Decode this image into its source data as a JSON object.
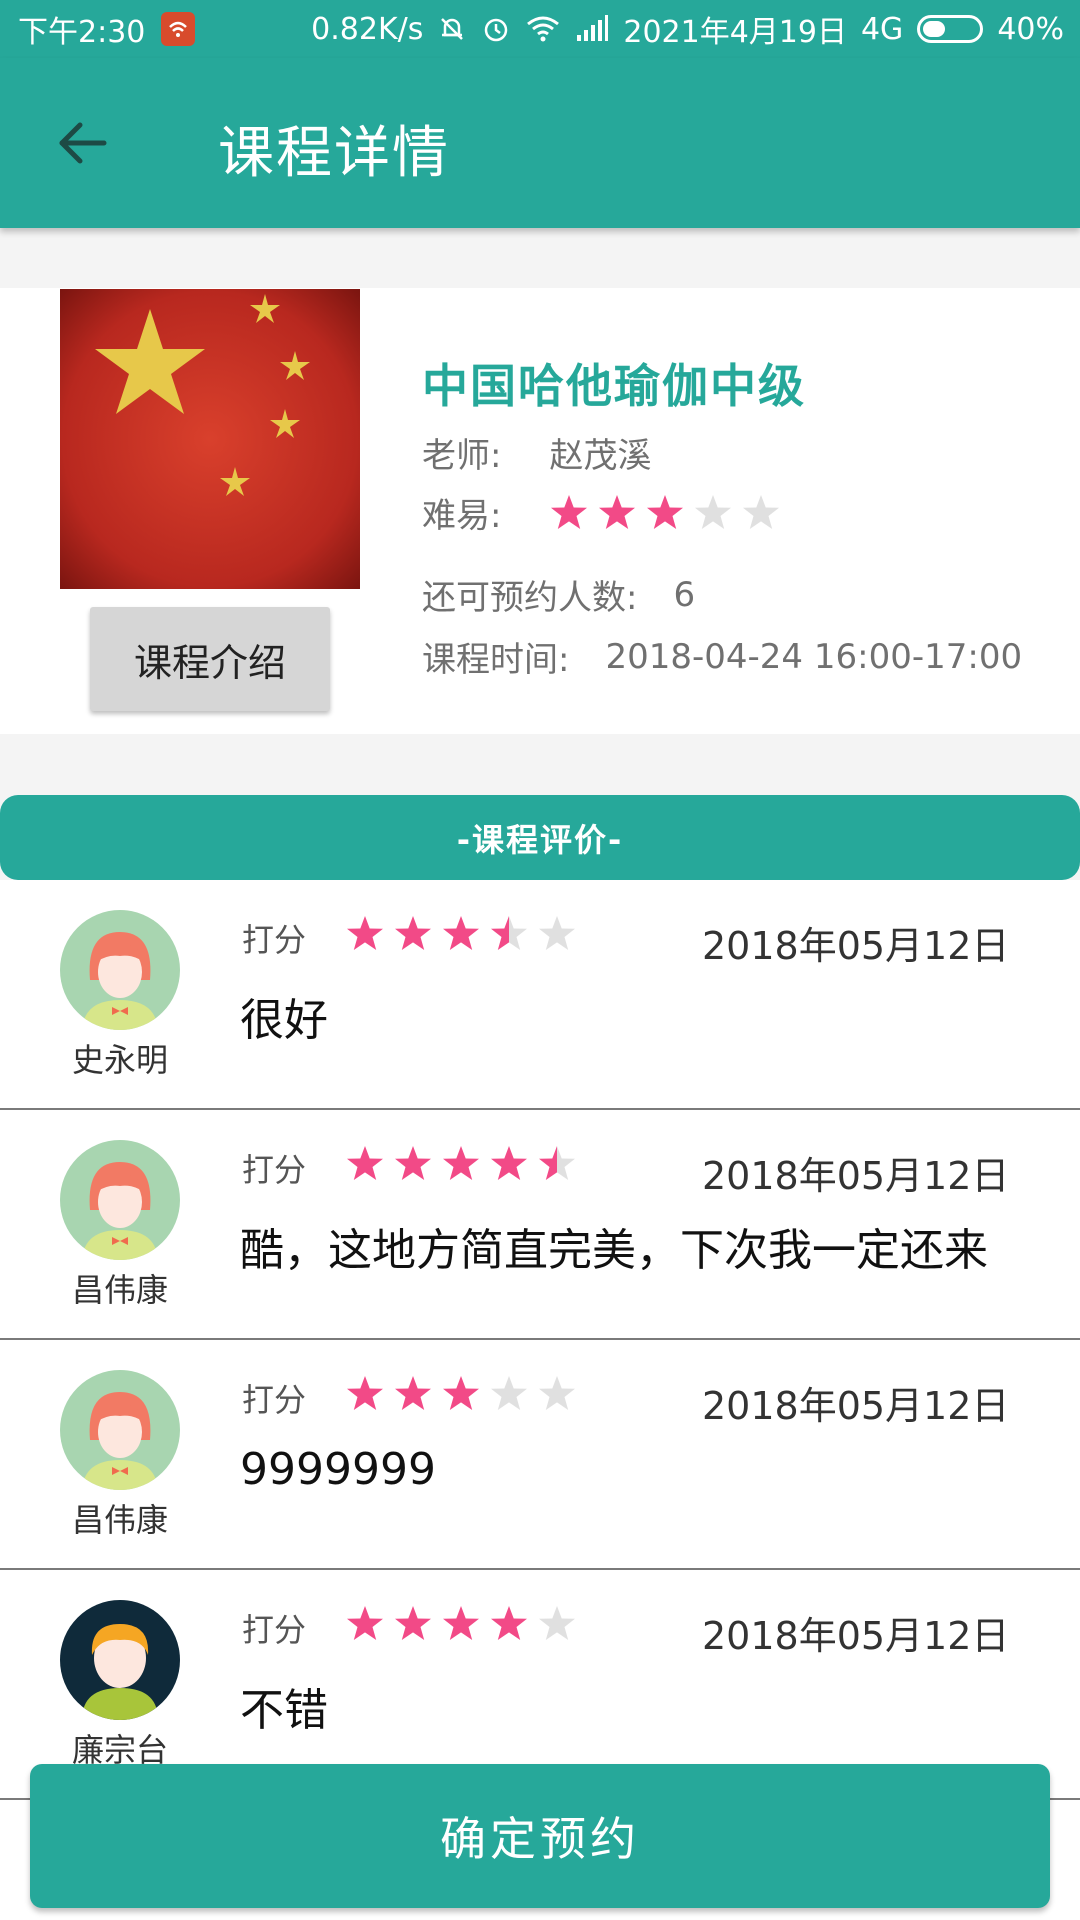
{
  "status_bar": {
    "time": "下午2:30",
    "net_speed": "0.82K/s",
    "date": "2021年4月19日",
    "network": "4G",
    "battery": "40%",
    "battery_level": 0.4,
    "icons": [
      "app-notification-icon",
      "mute-icon",
      "alarm-icon",
      "wifi-icon",
      "signal-icon",
      "battery-icon"
    ]
  },
  "app_bar": {
    "back_icon": "back-arrow-icon",
    "title": "课程详情"
  },
  "course": {
    "thumbnail": "china-flag-image",
    "intro_button": "课程介绍",
    "name": "中国哈他瑜伽中级",
    "teacher_label": "老师:",
    "teacher": "赵茂溪",
    "difficulty_label": "难易:",
    "difficulty": 3,
    "difficulty_max": 5,
    "capacity_label": "还可预约人数:",
    "capacity": "6",
    "time_label": "课程时间:",
    "time": "2018-04-24 16:00-17:00"
  },
  "reviews": {
    "header": "-课程评价-",
    "score_label": "打分",
    "items": [
      {
        "user": "史永明",
        "avatar": "girl-avatar",
        "rating": 3.5,
        "date": "2018年05月12日",
        "comment": "很好"
      },
      {
        "user": "昌伟康",
        "avatar": "girl-avatar",
        "rating": 4.5,
        "date": "2018年05月12日",
        "comment": "酷，这地方简直完美，下次我一定还来"
      },
      {
        "user": "昌伟康",
        "avatar": "girl-avatar",
        "rating": 3,
        "date": "2018年05月12日",
        "comment": "9999999"
      },
      {
        "user": "廉宗台",
        "avatar": "boy-avatar",
        "rating": 4,
        "date": "2018年05月12日",
        "comment": "不错"
      }
    ]
  },
  "confirm_button": "确定预约",
  "colors": {
    "primary": "#26a89a",
    "star_on": "#f24a87",
    "star_off": "#e0e0e0"
  }
}
